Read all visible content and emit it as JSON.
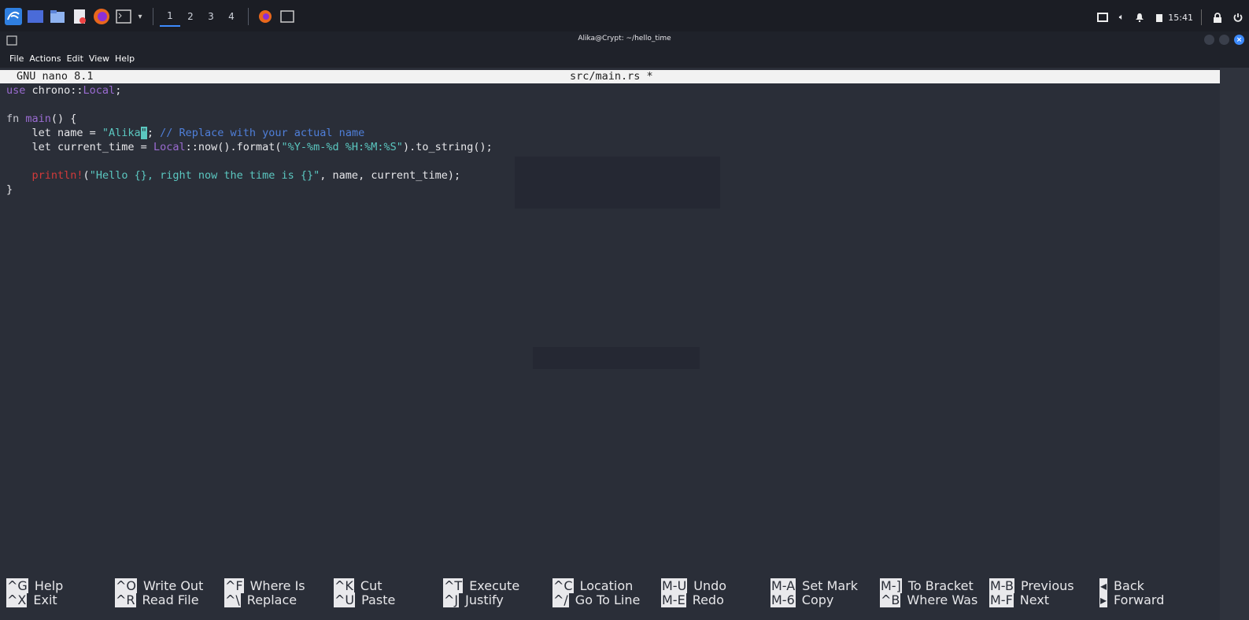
{
  "panel": {
    "workspaces": [
      "1",
      "2",
      "3",
      "4"
    ],
    "tray": {
      "time": "15:41"
    },
    "icons": [
      "kali-menu-icon",
      "desktop-icon",
      "file-manager-icon",
      "text-editor-icon",
      "firefox-icon",
      "terminal-icon",
      "chevron-down-icon",
      "firefox-task-icon",
      "terminal-task-icon",
      "screen-icon",
      "volume-icon",
      "notification-bell-icon",
      "battery-icon",
      "lock-icon",
      "power-icon"
    ]
  },
  "window": {
    "title": "Alika@Crypt: ~/hello_time",
    "menu": [
      "File",
      "Actions",
      "Edit",
      "View",
      "Help"
    ]
  },
  "nano": {
    "version": "GNU nano 8.1",
    "filename": "src/main.rs *",
    "code": {
      "l1_use": "use",
      "l1_path": " chrono::",
      "l1_local": "Local",
      "l1_end": ";",
      "l2_fn": "fn ",
      "l2_name": "main",
      "l2_rest": "() {",
      "l3_let": "    let name = ",
      "l3_str": "\"Alika",
      "l3_cursor": "\"",
      "l3_semi": ";",
      "l3_comment": " // Replace with your actual name",
      "l4_let": "    let current_time = ",
      "l4_local": "Local",
      "l4_mid": "::now().format(",
      "l4_str": "\"%Y-%m-%d %H:%M:%S\"",
      "l4_end": ").to_string();",
      "l5_indent": "    ",
      "l5_macro": "println!",
      "l5_open": "(",
      "l5_str": "\"Hello {}, right now the time is {}\"",
      "l5_end": ", name, current_time);",
      "l6": "}"
    },
    "shortcuts": [
      {
        "key": "^G",
        "label": "Help"
      },
      {
        "key": "^X",
        "label": "Exit"
      },
      {
        "key": "^O",
        "label": "Write Out"
      },
      {
        "key": "^R",
        "label": "Read File"
      },
      {
        "key": "^F",
        "label": "Where Is"
      },
      {
        "key": "^\\",
        "label": "Replace"
      },
      {
        "key": "^K",
        "label": "Cut"
      },
      {
        "key": "^U",
        "label": "Paste"
      },
      {
        "key": "^T",
        "label": "Execute"
      },
      {
        "key": "^J",
        "label": "Justify"
      },
      {
        "key": "^C",
        "label": "Location"
      },
      {
        "key": "^/",
        "label": "Go To Line"
      },
      {
        "key": "M-U",
        "label": "Undo"
      },
      {
        "key": "M-E",
        "label": "Redo"
      },
      {
        "key": "M-A",
        "label": "Set Mark"
      },
      {
        "key": "M-6",
        "label": "Copy"
      },
      {
        "key": "M-]",
        "label": "To Bracket"
      },
      {
        "key": "^B",
        "label": "Where Was"
      },
      {
        "key": "M-B",
        "label": "Previous"
      },
      {
        "key": "M-F",
        "label": "Next"
      },
      {
        "key": "◂",
        "label": "Back"
      },
      {
        "key": "▸",
        "label": "Forward"
      }
    ]
  },
  "colors": {
    "background": "#2a2e38",
    "accent": "#3d8bfd",
    "string": "#5bc7c0",
    "comment": "#4f7fd9",
    "type": "#9a6bd1",
    "macro": "#d23a3a"
  }
}
